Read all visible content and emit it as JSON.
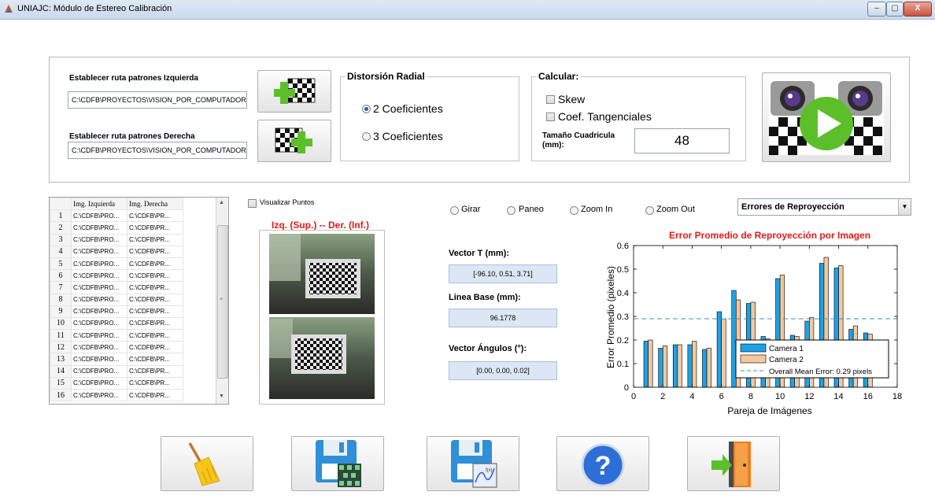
{
  "window": {
    "title": "UNIAJC: Módulo de Estereo Calibración",
    "minimize": "–",
    "maximize": "▢",
    "close": "X"
  },
  "paths": {
    "left_label": "Establecer ruta patrones Izquierda",
    "left_value": "C:\\CDFB\\PROYECTOS\\VISION_POR_COMPUTADOR",
    "right_label": "Establecer ruta patrones Derecha",
    "right_value": "C:\\CDFB\\PROYECTOS\\VISION_POR_COMPUTADOR"
  },
  "distortion": {
    "title": "Distorsión Radial",
    "opt2": "2 Coeficientes",
    "opt3": "3 Coeficientes",
    "selected": "2"
  },
  "calcular": {
    "title": "Calcular:",
    "skew": "Skew",
    "tangential": "Coef. Tangenciales",
    "square_label": "Tamaño Cuadricula (mm):",
    "square_value": "48"
  },
  "table": {
    "headers": [
      "Img. Izquierda",
      "Img. Derecha"
    ],
    "rows": [
      [
        "1",
        "C:\\CDFB\\PRO...",
        "C:\\CDFB\\PR..."
      ],
      [
        "2",
        "C:\\CDFB\\PRO...",
        "C:\\CDFB\\PR..."
      ],
      [
        "3",
        "C:\\CDFB\\PRO...",
        "C:\\CDFB\\PR..."
      ],
      [
        "4",
        "C:\\CDFB\\PRO...",
        "C:\\CDFB\\PR..."
      ],
      [
        "5",
        "C:\\CDFB\\PRO...",
        "C:\\CDFB\\PR..."
      ],
      [
        "6",
        "C:\\CDFB\\PRO...",
        "C:\\CDFB\\PR..."
      ],
      [
        "7",
        "C:\\CDFB\\PRO...",
        "C:\\CDFB\\PR..."
      ],
      [
        "8",
        "C:\\CDFB\\PRO...",
        "C:\\CDFB\\PR..."
      ],
      [
        "9",
        "C:\\CDFB\\PRO...",
        "C:\\CDFB\\PR..."
      ],
      [
        "10",
        "C:\\CDFB\\PRO...",
        "C:\\CDFB\\PR..."
      ],
      [
        "11",
        "C:\\CDFB\\PRO...",
        "C:\\CDFB\\PR..."
      ],
      [
        "12",
        "C:\\CDFB\\PRO...",
        "C:\\CDFB\\PR..."
      ],
      [
        "13",
        "C:\\CDFB\\PRO...",
        "C:\\CDFB\\PR..."
      ],
      [
        "14",
        "C:\\CDFB\\PRO...",
        "C:\\CDFB\\PR..."
      ],
      [
        "15",
        "C:\\CDFB\\PRO...",
        "C:\\CDFB\\PR..."
      ],
      [
        "16",
        "C:\\CDFB\\PRO...",
        "C:\\CDFB\\PR..."
      ]
    ]
  },
  "preview": {
    "show_points": "Visualizar Puntos",
    "caption": "Izq. (Sup.) -- Der. (Inf.)"
  },
  "view_modes": {
    "rotate": "Girar",
    "pan": "Paneo",
    "zoom_in": "Zoom In",
    "zoom_out": "Zoom Out"
  },
  "plot_select": {
    "value": "Errores de Reproyección"
  },
  "results": {
    "vector_t_label": "Vector T (mm):",
    "vector_t_value": "[-96.10, 0.51, 3.71]",
    "baseline_label": "Linea Base (mm):",
    "baseline_value": "96.1778",
    "angles_label": "Vector Ángulos (°):",
    "angles_value": "[0.00, 0.00, 0.02]"
  },
  "colors": {
    "camera1": "#1ea1e6",
    "camera2": "#f1c9a0",
    "mean_line": "#3b8fb9",
    "title_red": "#e81818",
    "accent_green": "#5cbf2a"
  },
  "chart_data": {
    "type": "bar",
    "title": "Error Promedio de Reproyección por Imagen",
    "xlabel": "Pareja de Imágenes",
    "ylabel": "Error Promedio (pixeles)",
    "xlim": [
      0,
      18
    ],
    "ylim": [
      0,
      0.6
    ],
    "xticks": [
      0,
      2,
      4,
      6,
      8,
      10,
      12,
      14,
      16,
      18
    ],
    "yticks": [
      0,
      0.1,
      0.2,
      0.3,
      0.4,
      0.5,
      0.6
    ],
    "x": [
      1,
      2,
      3,
      4,
      5,
      6,
      7,
      8,
      9,
      10,
      11,
      12,
      13,
      14,
      15,
      16
    ],
    "series": [
      {
        "name": "Camera 1",
        "values": [
          0.195,
          0.165,
          0.18,
          0.18,
          0.16,
          0.32,
          0.41,
          0.355,
          0.215,
          0.46,
          0.22,
          0.28,
          0.525,
          0.505,
          0.245,
          0.23
        ]
      },
      {
        "name": "Camera 2",
        "values": [
          0.2,
          0.175,
          0.18,
          0.195,
          0.165,
          0.29,
          0.37,
          0.36,
          0.205,
          0.475,
          0.215,
          0.295,
          0.55,
          0.515,
          0.26,
          0.225
        ]
      }
    ],
    "mean_line": {
      "name": "Overall Mean Error: 0.29 pixels",
      "value": 0.29
    },
    "legend": "bottom-right"
  },
  "toolbar": {
    "icons": [
      "broom-icon",
      "save-data-icon",
      "save-report-icon",
      "help-icon",
      "exit-icon"
    ]
  }
}
